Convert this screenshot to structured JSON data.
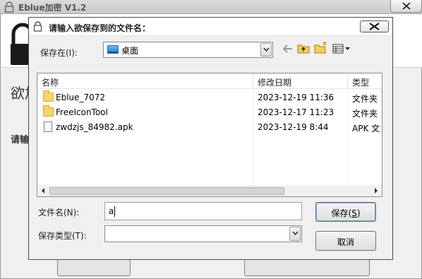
{
  "parent": {
    "title": "Eblue加密 V1.2",
    "heading_partial": "欲加",
    "label_partial": "请输"
  },
  "dialog": {
    "title": "请输入欲保存到的文件名：",
    "save_in_label": "保存在(I):",
    "save_in_value": "桌面",
    "columns": [
      "名称",
      "修改日期",
      "类型"
    ],
    "files": [
      {
        "name": "Eblue_7072",
        "modified": "2023-12-19 11:36",
        "type": "文件夹",
        "icon": "folder-icon"
      },
      {
        "name": "FreeIconTool",
        "modified": "2023-12-17 11:23",
        "type": "文件夹",
        "icon": "folder-icon"
      },
      {
        "name": "zwdzjs_84982.apk",
        "modified": "2023-12-19 8:44",
        "type": "APK 文件",
        "icon": "file-icon"
      }
    ],
    "filename_label": "文件名(N):",
    "filename_value": "a",
    "filetype_label": "保存类型(T):",
    "filetype_value": "",
    "save_button": {
      "text": "保存(",
      "accel": "S",
      "close": ")"
    },
    "cancel_button": "取消"
  }
}
